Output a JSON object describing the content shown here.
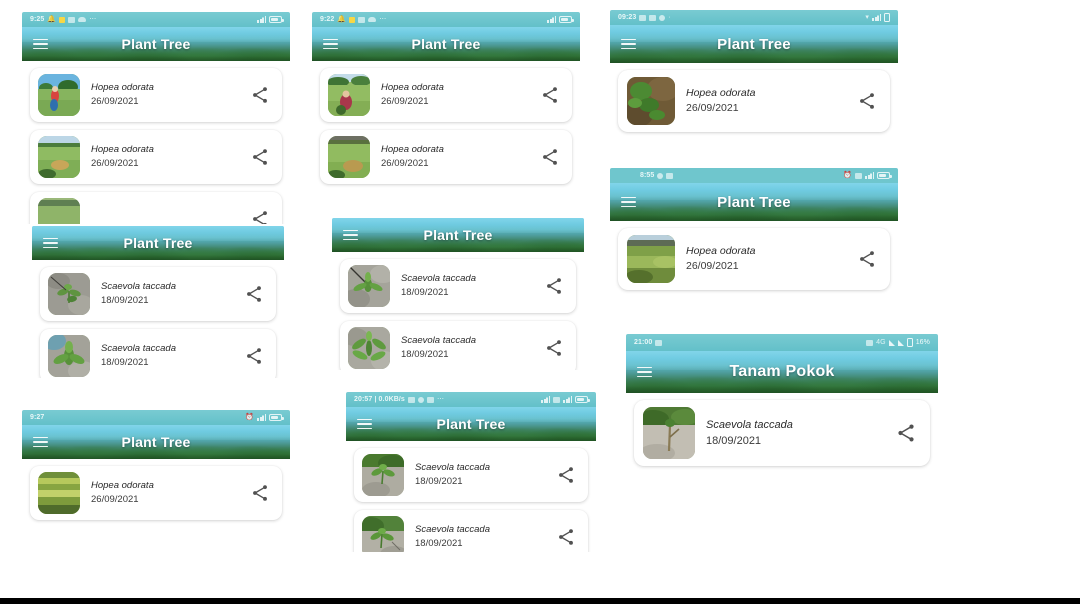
{
  "meta": {
    "app_title": "Plant Tree",
    "app_title_alt": "Tanam Pokok",
    "accent_teal": "#4fc2e0",
    "appbar_green": "#275f31",
    "statusbar_teal": "#6fc6cd",
    "card_bg": "#ffffff",
    "page_bg": "#ffffff"
  },
  "icons": {
    "menu": "hamburger-menu-icon",
    "share": "share-icon",
    "alarm": "alarm-icon",
    "battery": "battery-icon",
    "signal": "signal-bars-icon",
    "wifi": "wifi-icon"
  },
  "panels": [
    {
      "id": "panel-1",
      "statusbar": {
        "time": "9:25",
        "right_text": "",
        "icons_left": [
          "bell-icon",
          "weather-sun-icon",
          "message-icon",
          "cloud-icon",
          "more-icon"
        ],
        "icons_right": [
          "signal-bars-icon",
          "battery-icon"
        ]
      },
      "appbar": {
        "title": "Plant Tree"
      },
      "cards": [
        {
          "species": "Hopea odorata",
          "date": "26/09/2021",
          "thumb": "photo-person-field",
          "share": "share-icon"
        },
        {
          "species": "Hopea odorata",
          "date": "26/09/2021",
          "thumb": "photo-green-field",
          "share": "share-icon"
        },
        {
          "species": "",
          "date": "",
          "thumb": "photo-clipped",
          "share": "share-icon",
          "clipped": true
        }
      ]
    },
    {
      "id": "panel-2",
      "statusbar": null,
      "appbar": {
        "title": "Plant Tree"
      },
      "cards": [
        {
          "species": "Scaevola taccada",
          "date": "18/09/2021",
          "thumb": "photo-sand-seedling",
          "share": "share-icon"
        },
        {
          "species": "Scaevola taccada",
          "date": "18/09/2021",
          "thumb": "photo-sand-plant",
          "share": "share-icon"
        }
      ]
    },
    {
      "id": "panel-3",
      "statusbar": {
        "time": "9:27",
        "right_text": "",
        "icons_left": [],
        "icons_right": [
          "alarm-icon",
          "signal-bars-icon",
          "battery-icon"
        ]
      },
      "appbar": {
        "title": "Plant Tree"
      },
      "cards": [
        {
          "species": "Hopea odorata",
          "date": "26/09/2021",
          "thumb": "photo-grass-rows",
          "share": "share-icon"
        }
      ]
    },
    {
      "id": "panel-4",
      "statusbar": {
        "time": "9:22",
        "right_text": "",
        "icons_left": [
          "bell-icon",
          "weather-sun-icon",
          "message-icon",
          "cloud-icon",
          "more-icon"
        ],
        "icons_right": [
          "signal-bars-icon",
          "battery-icon"
        ]
      },
      "appbar": {
        "title": "Plant Tree"
      },
      "cards": [
        {
          "species": "Hopea odorata",
          "date": "26/09/2021",
          "thumb": "photo-person-planting",
          "share": "share-icon"
        },
        {
          "species": "Hopea odorata",
          "date": "26/09/2021",
          "thumb": "photo-paddy-field",
          "share": "share-icon"
        }
      ]
    },
    {
      "id": "panel-5",
      "statusbar": null,
      "appbar": {
        "title": "Plant Tree"
      },
      "cards": [
        {
          "species": "Scaevola taccada",
          "date": "18/09/2021",
          "thumb": "photo-rock-plant",
          "share": "share-icon"
        },
        {
          "species": "Scaevola taccada",
          "date": "18/09/2021",
          "thumb": "photo-rock-leaves",
          "share": "share-icon"
        }
      ]
    },
    {
      "id": "panel-6",
      "statusbar": {
        "time": "20:57 | 0.0KB/s",
        "right_text": "",
        "icons_left": [
          "alarm-icon",
          "mute-icon",
          "message-icon",
          "more-icon"
        ],
        "icons_right": [
          "signal-bars-icon",
          "sim-icon",
          "signal-bars-icon",
          "battery-icon"
        ]
      },
      "appbar": {
        "title": "Plant Tree"
      },
      "cards": [
        {
          "species": "Scaevola taccada",
          "date": "18/09/2021",
          "thumb": "photo-seedling-soil",
          "share": "share-icon"
        },
        {
          "species": "Scaevola taccada",
          "date": "18/09/2021",
          "thumb": "photo-seedling-soil-2",
          "share": "share-icon"
        }
      ]
    },
    {
      "id": "panel-7",
      "statusbar": {
        "time": "09:23",
        "right_text": "",
        "icons_left": [
          "image-icon",
          "message-icon",
          "facebook-icon",
          "more-icon"
        ],
        "icons_right": [
          "wifi-icon",
          "signal-bars-icon",
          "battery-icon"
        ]
      },
      "appbar": {
        "title": "Plant Tree"
      },
      "cards": [
        {
          "species": "Hopea odorata",
          "date": "26/09/2021",
          "thumb": "photo-seedling-ground",
          "share": "share-icon"
        }
      ]
    },
    {
      "id": "panel-8",
      "statusbar": {
        "time": "8:55",
        "right_text": "",
        "icons_left": [
          "mute-icon",
          "message-icon"
        ],
        "icons_right": [
          "alarm-icon",
          "hd-icon",
          "signal-bars-icon",
          "battery-icon"
        ]
      },
      "appbar": {
        "title": "Plant Tree"
      },
      "cards": [
        {
          "species": "Hopea odorata",
          "date": "26/09/2021",
          "thumb": "photo-field-trees",
          "share": "share-icon"
        }
      ]
    },
    {
      "id": "panel-9",
      "statusbar": {
        "time": "21:00",
        "right_text": "16%",
        "network": "4G",
        "icons_left": [
          "screenshot-icon"
        ],
        "icons_right": [
          "data-icon",
          "signal-bars-icon",
          "signal-bars-icon",
          "battery-icon"
        ]
      },
      "appbar": {
        "title": "Tanam Pokok"
      },
      "cards": [
        {
          "species": "Scaevola taccada",
          "date": "18/09/2021",
          "thumb": "photo-mangrove-sand",
          "share": "share-icon"
        }
      ]
    }
  ]
}
